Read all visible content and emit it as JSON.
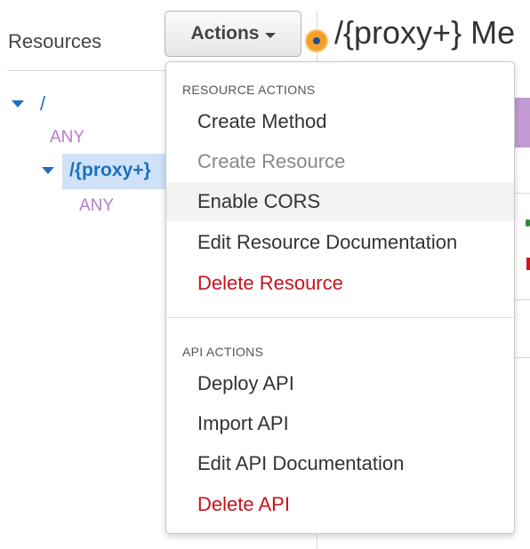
{
  "resources": {
    "header": "Resources",
    "root": {
      "label": "/",
      "methods": [
        "ANY"
      ]
    },
    "proxy": {
      "label": "/{proxy+}",
      "methods": [
        "ANY"
      ]
    }
  },
  "page": {
    "title": "/{proxy+} Me"
  },
  "actions_button": {
    "label": "Actions"
  },
  "menu": {
    "resource_heading": "RESOURCE ACTIONS",
    "resource_items": [
      {
        "label": "Create Method",
        "state": "normal"
      },
      {
        "label": "Create Resource",
        "state": "disabled"
      },
      {
        "label": "Enable CORS",
        "state": "hover"
      },
      {
        "label": "Edit Resource Documentation",
        "state": "normal"
      },
      {
        "label": "Delete Resource",
        "state": "danger"
      }
    ],
    "api_heading": "API ACTIONS",
    "api_items": [
      {
        "label": "Deploy API",
        "state": "normal"
      },
      {
        "label": "Import API",
        "state": "normal"
      },
      {
        "label": "Edit API Documentation",
        "state": "normal"
      },
      {
        "label": "Delete API",
        "state": "danger"
      }
    ]
  },
  "colors": {
    "link_blue": "#1f6fbf",
    "method_purple": "#b57bcf",
    "danger_red": "#c7131d",
    "selection_bg": "#cfe2f7"
  }
}
